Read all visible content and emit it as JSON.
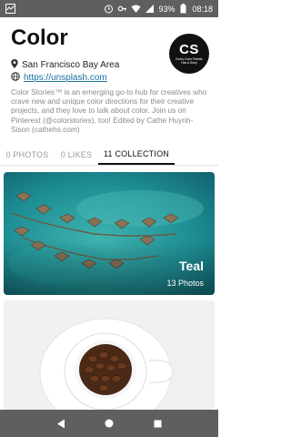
{
  "status_bar": {
    "battery": "93%",
    "time": "08:18"
  },
  "profile": {
    "name": "Color",
    "avatar_logo_text": "CS",
    "avatar_tagline": "Every Color Palette Has A Story",
    "location": "San Francisco Bay Area",
    "website": "https://unsplash.com",
    "bio": "Color Stories™ is an emerging go-to hub for creatives who crave new and unique color directions for their creative projects, and they love to talk about color. Join us on Pinterest (@colorstories), too! Edited by Cathe Huynh-Sison (cathehs.com)"
  },
  "tabs": [
    {
      "label": "0 PHOTOS"
    },
    {
      "label": "0 LIKES"
    },
    {
      "label": "11 COLLECTION"
    }
  ],
  "collections": [
    {
      "title": "Teal",
      "count": "13 Photos"
    }
  ],
  "icons": {
    "location": "location-pin-icon",
    "website": "globe-icon",
    "back": "back-icon",
    "home": "home-icon",
    "recents": "recents-icon"
  },
  "colors": {
    "teal_water": "#1e8f95",
    "teal_deep": "#0f6a74",
    "status_bar": "#5f5f5f",
    "link": "#1a6fa0"
  }
}
